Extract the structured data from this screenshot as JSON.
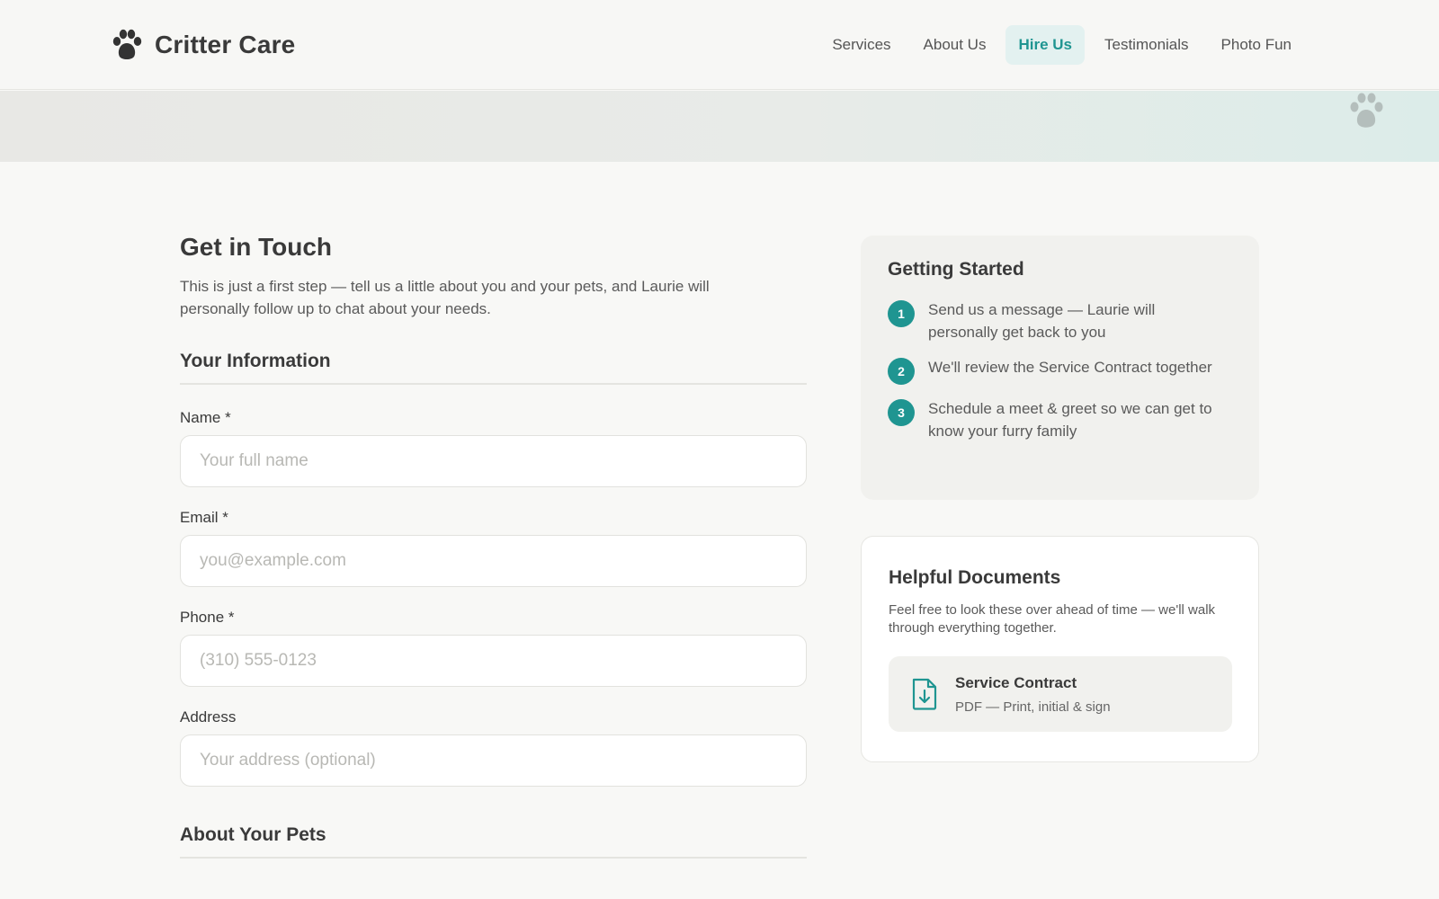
{
  "brand": {
    "name": "Critter Care",
    "logo_icon": "paw-icon",
    "accent_color": "#1f9591"
  },
  "nav": {
    "items": [
      {
        "label": "Services",
        "active": false
      },
      {
        "label": "About Us",
        "active": false
      },
      {
        "label": "Hire Us",
        "active": true
      },
      {
        "label": "Testimonials",
        "active": false
      },
      {
        "label": "Photo Fun",
        "active": false
      }
    ]
  },
  "main": {
    "title": "Get in Touch",
    "intro": "This is just a first step — tell us a little about you and your pets, and Laurie will personally follow up to chat about your needs.",
    "section_info": "Your Information",
    "fields": {
      "name": {
        "label": "Name *",
        "placeholder": "Your full name",
        "value": ""
      },
      "email": {
        "label": "Email *",
        "placeholder": "you@example.com",
        "value": ""
      },
      "phone": {
        "label": "Phone *",
        "placeholder": "(310) 555-0123",
        "value": ""
      },
      "address": {
        "label": "Address",
        "placeholder": "Your address (optional)",
        "value": ""
      }
    },
    "section_pets": "About Your Pets"
  },
  "getting_started": {
    "title": "Getting Started",
    "steps": [
      {
        "num": "1",
        "text": "Send us a message — Laurie will personally get back to you"
      },
      {
        "num": "2",
        "text": "We'll review the Service Contract together"
      },
      {
        "num": "3",
        "text": "Schedule a meet & greet so we can get to know your furry family"
      }
    ]
  },
  "documents": {
    "title": "Helpful Documents",
    "description": "Feel free to look these over ahead of time — we'll walk through everything together.",
    "items": [
      {
        "title": "Service Contract",
        "subtitle": "PDF — Print, initial & sign",
        "icon": "file-download-icon"
      }
    ]
  }
}
